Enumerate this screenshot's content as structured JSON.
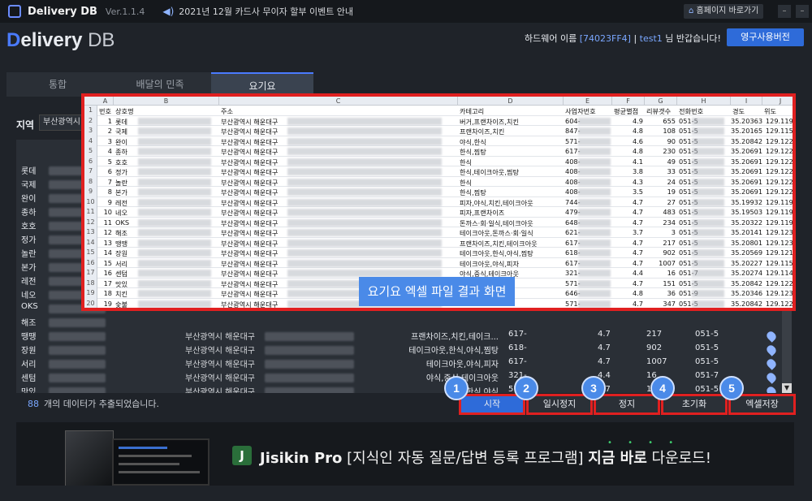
{
  "titlebar": {
    "app_name": "Delivery DB",
    "version": "Ver.1.1.4",
    "notice": "2021년 12월 카드사 무이자 할부 이벤트 안내",
    "home_link": "홈페이지 바로가기",
    "minimize": "–",
    "close": "–"
  },
  "header": {
    "brand_d": "D",
    "brand_elivery": "elivery",
    "brand_db": " DB",
    "hw_label": "하드웨어 이름",
    "hw_value": "[74023FF4]",
    "separator": "|",
    "user": "test1",
    "greeting": "님 반갑습니다!",
    "perm_button": "영구사용버전"
  },
  "tabs": [
    {
      "label": "통합"
    },
    {
      "label": "배달의 민족"
    },
    {
      "label": "요기요"
    }
  ],
  "region": {
    "label": "지역",
    "value": "부산광역시"
  },
  "grid_rows": [
    {
      "name": "롯데",
      "addr": "",
      "cat": "",
      "biz": "",
      "rate": "",
      "rev": "",
      "tel": ""
    },
    {
      "name": "국제",
      "addr": "",
      "cat": "",
      "biz": "",
      "rate": "",
      "rev": "",
      "tel": ""
    },
    {
      "name": "완이",
      "addr": "",
      "cat": "",
      "biz": "",
      "rate": "",
      "rev": "",
      "tel": ""
    },
    {
      "name": "종하",
      "addr": "",
      "cat": "",
      "biz": "",
      "rate": "",
      "rev": "",
      "tel": ""
    },
    {
      "name": "호호",
      "addr": "",
      "cat": "",
      "biz": "",
      "rate": "",
      "rev": "",
      "tel": ""
    },
    {
      "name": "정가",
      "addr": "",
      "cat": "",
      "biz": "",
      "rate": "",
      "rev": "",
      "tel": ""
    },
    {
      "name": "놀란",
      "addr": "",
      "cat": "",
      "biz": "",
      "rate": "",
      "rev": "",
      "tel": ""
    },
    {
      "name": "본가",
      "addr": "",
      "cat": "",
      "biz": "",
      "rate": "",
      "rev": "",
      "tel": ""
    },
    {
      "name": "레전",
      "addr": "",
      "cat": "",
      "biz": "",
      "rate": "",
      "rev": "",
      "tel": ""
    },
    {
      "name": "네오",
      "addr": "",
      "cat": "",
      "biz": "",
      "rate": "",
      "rev": "",
      "tel": ""
    },
    {
      "name": "OKS",
      "addr": "",
      "cat": "",
      "biz": "",
      "rate": "",
      "rev": "",
      "tel": ""
    },
    {
      "name": "해조",
      "addr": "",
      "cat": "",
      "biz": "",
      "rate": "",
      "rev": "",
      "tel": ""
    },
    {
      "name": "땡땡",
      "addr": "부산광역시 해운대구",
      "cat": "프랜차이즈,치킨,테이크...",
      "biz": "617-",
      "rate": "4.7",
      "rev": "217",
      "tel": "051-5"
    },
    {
      "name": "장원",
      "addr": "부산광역시 해운대구",
      "cat": "테이크아웃,한식,야식,찜탕",
      "biz": "618-",
      "rate": "4.7",
      "rev": "902",
      "tel": "051-5"
    },
    {
      "name": "서리",
      "addr": "부산광역시 해운대구",
      "cat": "테이크아웃,야식,피자",
      "biz": "617-",
      "rate": "4.7",
      "rev": "1007",
      "tel": "051-5"
    },
    {
      "name": "센텀",
      "addr": "부산광역시 해운대구",
      "cat": "야식,중식,테이크아웃",
      "biz": "321-",
      "rate": "4.4",
      "rev": "16",
      "tel": "051-7"
    },
    {
      "name": "맛있",
      "addr": "부산광역시 해운대구",
      "cat": "한식,야식",
      "biz": "571-",
      "rate": "4.7",
      "rev": "151",
      "tel": "051-5"
    },
    {
      "name": "치킨",
      "addr": "부산광역시 해운대구",
      "cat": "테이크아웃,피자,",
      "biz": "64",
      "rate": "",
      "rev": "",
      "tel": "051-9"
    },
    {
      "name": "숯불",
      "addr": "부산광역시 해운대구",
      "cat": "한식",
      "biz": "",
      "rate": "",
      "rev": "",
      "tel": ""
    }
  ],
  "status": {
    "count": "88",
    "message": "개의 데이터가 추출되었습니다."
  },
  "controls": [
    {
      "label": "시작",
      "badge": "1"
    },
    {
      "label": "일시정지",
      "badge": "2"
    },
    {
      "label": "정지",
      "badge": "3"
    },
    {
      "label": "초기화",
      "badge": "4"
    },
    {
      "label": "엑셀저장",
      "badge": "5"
    }
  ],
  "banner": {
    "logo_letter": "J",
    "product": "Jisikin Pro",
    "desc": " [지식인 자동 질문/답변 등록 프로그램] ",
    "cta_bold": "지금 바로",
    "cta": " 다운로드!"
  },
  "excel": {
    "caption": "요기요 엑셀 파일 결과 화면",
    "columns": [
      "A",
      "B",
      "C",
      "D",
      "E",
      "F",
      "G",
      "H",
      "I",
      "J"
    ],
    "headers": [
      "번호",
      "상호명",
      "주소",
      "카테고리",
      "사업자번호",
      "평균별점",
      "리뷰갯수",
      "전화번호",
      "경도",
      "위도"
    ],
    "rows": [
      [
        "1",
        "롯데",
        "부산광역시 해운대구",
        "버거,프랜차이즈,치킨",
        "604-",
        "4.9",
        "655",
        "051-5",
        "35.20363",
        "129.1197"
      ],
      [
        "2",
        "국제",
        "부산광역시 해운대구",
        "프랜차이즈,치킨",
        "847-",
        "4.8",
        "108",
        "051-5",
        "35.20165",
        "129.1159"
      ],
      [
        "3",
        "완이",
        "부산광역시 해운대구",
        "야식,한식",
        "571-",
        "4.6",
        "90",
        "051-5",
        "35.20842",
        "129.1224"
      ],
      [
        "4",
        "종하",
        "부산광역시 해운대구",
        "한식,찜탕",
        "617-",
        "4.8",
        "230",
        "051-5",
        "35.20691",
        "129.1229"
      ],
      [
        "5",
        "호호",
        "부산광역시 해운대구",
        "한식",
        "408-",
        "4.1",
        "49",
        "051-5",
        "35.20691",
        "129.1229"
      ],
      [
        "6",
        "정가",
        "부산광역시 해운대구",
        "한식,테이크아웃,찜탕",
        "408-",
        "3.8",
        "33",
        "051-5",
        "35.20691",
        "129.1229"
      ],
      [
        "7",
        "놀란",
        "부산광역시 해운대구",
        "한식",
        "408-",
        "4.3",
        "24",
        "051-5",
        "35.20691",
        "129.1229"
      ],
      [
        "8",
        "본가",
        "부산광역시 해운대구",
        "한식,찜탕",
        "408-",
        "3.5",
        "19",
        "051-5",
        "35.20691",
        "129.1229"
      ],
      [
        "9",
        "레전",
        "부산광역시 해운대구",
        "피자,야식,치킨,테이크아웃",
        "744-",
        "4.7",
        "27",
        "051-5",
        "35.19932",
        "129.1197"
      ],
      [
        "10",
        "네오",
        "부산광역시 해운대구",
        "피자,프랜차이즈",
        "479-",
        "4.7",
        "483",
        "051-5",
        "35.19503",
        "129.1197"
      ],
      [
        "11",
        "OKS",
        "부산광역시 해운대구",
        "돈까스·회·일식,테이크아웃",
        "648-",
        "4.7",
        "234",
        "051-5",
        "35.20322",
        "129.1198"
      ],
      [
        "12",
        "해조",
        "부산광역시 해운대구",
        "테이크아웃,돈까스·회·일식",
        "621-",
        "3.7",
        "3",
        "051-5",
        "35.20141",
        "129.1238"
      ],
      [
        "13",
        "땡땡",
        "부산광역시 해운대구",
        "프랜차이즈,치킨,테이크아웃",
        "617-",
        "4.7",
        "217",
        "051-5",
        "35.20801",
        "129.1235"
      ],
      [
        "14",
        "장원",
        "부산광역시 해운대구",
        "테이크아웃,한식,야식,찜탕",
        "618-",
        "4.7",
        "902",
        "051-5",
        "35.20569",
        "129.1218"
      ],
      [
        "15",
        "서리",
        "부산광역시 해운대구",
        "테이크아웃,야식,피자",
        "617-",
        "4.7",
        "1007",
        "051-5",
        "35.20227",
        "129.1154"
      ],
      [
        "16",
        "센텀",
        "부산광역시 해운대구",
        "야식,중식,테이크아웃",
        "321-",
        "4.4",
        "16",
        "051-7",
        "35.20274",
        "129.1147"
      ],
      [
        "17",
        "맛있",
        "부산광역시 해운대구",
        "",
        "571-",
        "4.7",
        "151",
        "051-5",
        "35.20842",
        "129.1224"
      ],
      [
        "18",
        "치킨",
        "부산광역시 해운대구",
        "킨,프랜차이즈",
        "646-",
        "4.8",
        "36",
        "051-9",
        "35.20346",
        "129.1233"
      ],
      [
        "19",
        "숯불",
        "부산광역시 해운대구",
        "",
        "571-",
        "4.7",
        "347",
        "051-5",
        "35.20842",
        "129.1224"
      ]
    ]
  }
}
